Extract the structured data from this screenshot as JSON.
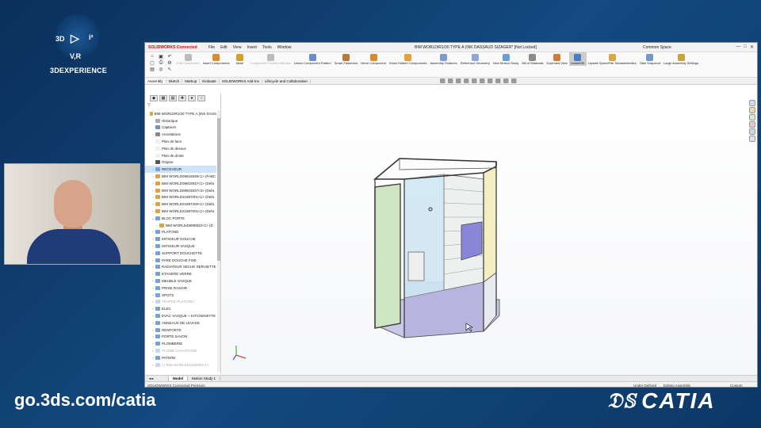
{
  "brand": {
    "name": "3DEXPERIENCE",
    "mark_labels": [
      "3D",
      "i²",
      "V,R"
    ]
  },
  "url": "go.3ds.com/catia",
  "catia_logo": "CATIA",
  "app": {
    "logo": "SOLIDWORKS Connected",
    "menus": [
      "File",
      "Edit",
      "View",
      "Insert",
      "Tools",
      "Window"
    ],
    "doc_title": "BIM WORLDIR1/30 TYPE A (INK DASSAUD SIZAGER* [Not Locked]",
    "space": "Common Space",
    "ribbon": [
      {
        "label": "Edit Component",
        "state": "dis",
        "color": "#bbb"
      },
      {
        "label": "Insert Components",
        "state": "",
        "color": "#d98c2b"
      },
      {
        "label": "Mate",
        "state": "",
        "color": "#d0a030"
      },
      {
        "label": "Component Preview Window",
        "state": "dis",
        "color": "#bbb"
      },
      {
        "label": "Linear Component Pattern",
        "state": "",
        "color": "#6a8fc7"
      },
      {
        "label": "Smart Fasteners",
        "state": "",
        "color": "#b57a3a"
      },
      {
        "label": "Move Component",
        "state": "",
        "color": "#d58c2c"
      },
      {
        "label": "Show Hidden Components",
        "state": "",
        "color": "#e2a13c"
      },
      {
        "label": "Assembly Features",
        "state": "",
        "color": "#7a9bd1"
      },
      {
        "label": "Reference Geometry",
        "state": "",
        "color": "#8da7d8"
      },
      {
        "label": "New Motion Study",
        "state": "",
        "color": "#6aa0cf"
      },
      {
        "label": "Bill of Materials",
        "state": "",
        "color": "#8a8a8a"
      },
      {
        "label": "Exploded View",
        "state": "",
        "color": "#cf7b3a"
      },
      {
        "label": "Instant3D",
        "state": "active",
        "color": "#4a7ec2"
      },
      {
        "label": "Update SpeedPak Subassemblies",
        "state": "",
        "color": "#d7a846"
      },
      {
        "label": "Take Snapshot",
        "state": "",
        "color": "#6f9ac9"
      },
      {
        "label": "Large Assembly Settings",
        "state": "",
        "color": "#c9a340"
      }
    ],
    "tabs": [
      "Assembly",
      "Sketch",
      "Markup",
      "Evaluate",
      "SOLIDWORKS Add-Ins",
      "Lifecycle and Collaboration"
    ],
    "tree": [
      {
        "label": "BIM WORLDR1/30 TYPE A (INK DASS",
        "indent": 0,
        "caret": "",
        "color": "#d9a441",
        "state": ""
      },
      {
        "label": "Historique",
        "indent": 1,
        "caret": "",
        "color": "#aaa",
        "state": ""
      },
      {
        "label": "Capteurs",
        "indent": 1,
        "caret": "",
        "color": "#6f8fc7",
        "state": ""
      },
      {
        "label": "Annotations",
        "indent": 1,
        "caret": "›",
        "color": "#8a8a8a",
        "state": ""
      },
      {
        "label": "Plan de face",
        "indent": 1,
        "caret": "",
        "color": "#eee",
        "state": ""
      },
      {
        "label": "Plan de dessus",
        "indent": 1,
        "caret": "",
        "color": "#eee",
        "state": ""
      },
      {
        "label": "Plan de droite",
        "indent": 1,
        "caret": "",
        "color": "#eee",
        "state": ""
      },
      {
        "label": "Origine",
        "indent": 1,
        "caret": "",
        "color": "#555",
        "state": ""
      },
      {
        "label": "RECEVEUR",
        "indent": 1,
        "caret": "›",
        "color": "#7aa1d6",
        "state": "sel"
      },
      {
        "label": "BIM WORLD09915938<1> (FABC",
        "indent": 1,
        "caret": "›",
        "color": "#d9a441",
        "state": ""
      },
      {
        "label": "BIM WORLD09915937<1> (Defa",
        "indent": 1,
        "caret": "›",
        "color": "#d9a441",
        "state": ""
      },
      {
        "label": "BIM WORLD09915937<3> (Defa",
        "indent": 1,
        "caret": "›",
        "color": "#d9a441",
        "state": ""
      },
      {
        "label": "BIM WORLD21987001<1> (Defa",
        "indent": 1,
        "caret": "›",
        "color": "#d9a441",
        "state": ""
      },
      {
        "label": "BIM WORLD21987200<1> (Defa",
        "indent": 1,
        "caret": "›",
        "color": "#d9a441",
        "state": ""
      },
      {
        "label": "BIM WORLD21987001<1> (Defa",
        "indent": 1,
        "caret": "›",
        "color": "#d9a441",
        "state": ""
      },
      {
        "label": "BLOC PORTE",
        "indent": 1,
        "caret": "⌄",
        "color": "#7aa1d6",
        "state": ""
      },
      {
        "label": "BIM WORLD45895922<1> (D",
        "indent": 2,
        "caret": "›",
        "color": "#d9a441",
        "state": ""
      },
      {
        "label": "PLAFOND",
        "indent": 1,
        "caret": "›",
        "color": "#7aa1d6",
        "state": ""
      },
      {
        "label": "MITIGEUR DOUCHE",
        "indent": 1,
        "caret": "›",
        "color": "#7aa1d6",
        "state": ""
      },
      {
        "label": "MITIGEUR VASQUE",
        "indent": 1,
        "caret": "›",
        "color": "#7aa1d6",
        "state": ""
      },
      {
        "label": "SUPPORT DOUCHETTE",
        "indent": 1,
        "caret": "›",
        "color": "#7aa1d6",
        "state": ""
      },
      {
        "label": "PARE DOUCHE FIXE",
        "indent": 1,
        "caret": "›",
        "color": "#7aa1d6",
        "state": ""
      },
      {
        "label": "RADIATEUR SECHE SERVIETTE",
        "indent": 1,
        "caret": "›",
        "color": "#7aa1d6",
        "state": ""
      },
      {
        "label": "ETAGERE VERRE",
        "indent": 1,
        "caret": "›",
        "color": "#7aa1d6",
        "state": ""
      },
      {
        "label": "MEUBLE VASQUE",
        "indent": 1,
        "caret": "›",
        "color": "#7aa1d6",
        "state": ""
      },
      {
        "label": "PRISE RASOIR",
        "indent": 1,
        "caret": "›",
        "color": "#7aa1d6",
        "state": ""
      },
      {
        "label": "SPOTS",
        "indent": 1,
        "caret": "›",
        "color": "#7aa1d6",
        "state": ""
      },
      {
        "label": "TRAPPE PLAFOND",
        "indent": 1,
        "caret": "›",
        "color": "#c9d6ea",
        "state": "dim"
      },
      {
        "label": "ELEC",
        "indent": 1,
        "caret": "›",
        "color": "#7aa1d6",
        "state": ""
      },
      {
        "label": "EVAC VASQUE + KITCHENETTE",
        "indent": 1,
        "caret": "›",
        "color": "#7aa1d6",
        "state": ""
      },
      {
        "label": "ANNEAUX DE LEVAGE",
        "indent": 1,
        "caret": "›",
        "color": "#7aa1d6",
        "state": ""
      },
      {
        "label": "RENFORTS",
        "indent": 1,
        "caret": "›",
        "color": "#7aa1d6",
        "state": ""
      },
      {
        "label": "PORTE SAVON",
        "indent": 1,
        "caret": "›",
        "color": "#7aa1d6",
        "state": ""
      },
      {
        "label": "PLOMBERIE",
        "indent": 1,
        "caret": "›",
        "color": "#7aa1d6",
        "state": ""
      },
      {
        "label": "PLOMB CHAUFFAGE",
        "indent": 1,
        "caret": "›",
        "color": "#c9d6ea",
        "state": "dim"
      },
      {
        "label": "PATERE",
        "indent": 1,
        "caret": "›",
        "color": "#7aa1d6",
        "state": ""
      },
      {
        "label": "(-) BIM WORLD03150000<1>",
        "indent": 1,
        "caret": "›",
        "color": "#c9d6ea",
        "state": "dim"
      }
    ],
    "bottom_tabs": [
      "Model",
      "Motion Study 1"
    ],
    "status": {
      "left": "SOLIDWORKS Connected Premium",
      "under": "Under Defined",
      "editing": "Editing Assembly",
      "units": "Custom"
    }
  }
}
